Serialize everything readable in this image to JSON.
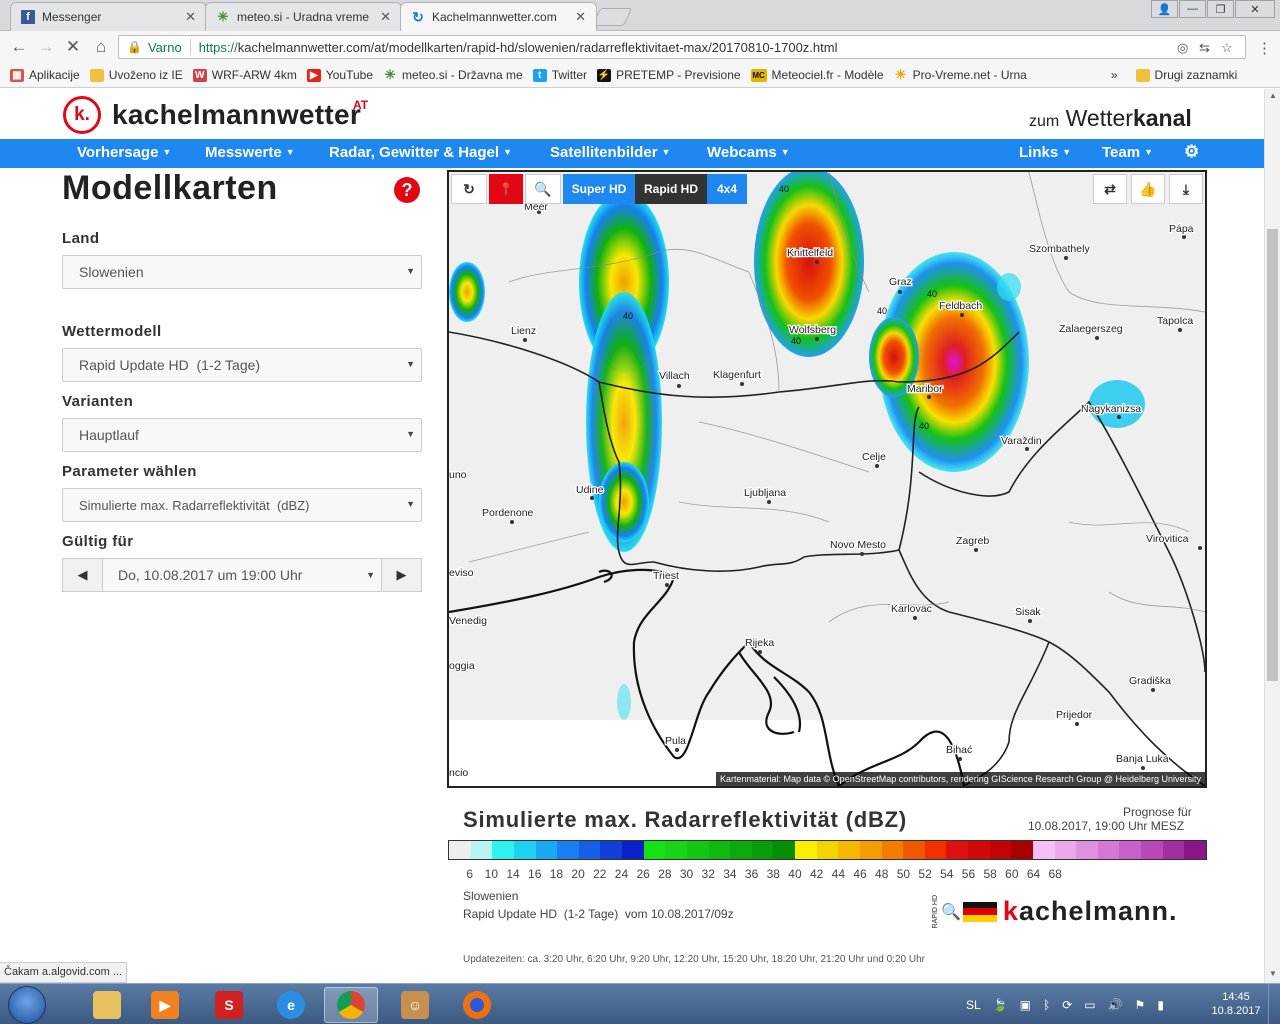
{
  "browser": {
    "tabs": [
      {
        "title": "Messenger",
        "color": "#3b5998",
        "glyph": "f"
      },
      {
        "title": "meteo.si - Uradna vreme",
        "color": "#4a8b3a",
        "glyph": "✳"
      },
      {
        "title": "Kachelmannwetter.com",
        "color": "#1a73e8",
        "glyph": "C"
      }
    ],
    "address": {
      "secure_label": "Varno",
      "url_scheme": "https://",
      "url_host": "kachelmannwetter.com",
      "url_path": "/at/modellkarten/rapid-hd/slowenien/radarreflektivitaet-max/20170810-1700z.html"
    },
    "bookmarks": [
      {
        "label": "Aplikacije",
        "color": "#d9534f",
        "glyph": "▦"
      },
      {
        "label": "Uvoženo iz IE",
        "color": "#f0c040",
        "glyph": ""
      },
      {
        "label": "WRF-ARW 4km",
        "color": "#c44",
        "glyph": "W"
      },
      {
        "label": "YouTube",
        "color": "#e62117",
        "glyph": "▶"
      },
      {
        "label": "meteo.si - Državna me",
        "color": "#4a8b3a",
        "glyph": "✳"
      },
      {
        "label": "Twitter",
        "color": "#1da1f2",
        "glyph": "t"
      },
      {
        "label": "PRETEMP - Previsione",
        "color": "#111",
        "glyph": "⚡"
      },
      {
        "label": "Meteociel.fr - Modèle",
        "color": "#e8b300",
        "glyph": "MC"
      },
      {
        "label": "Pro-Vreme.net - Urna",
        "color": "#f5a300",
        "glyph": "☀"
      }
    ],
    "bookmarks_more": "»",
    "bookmarks_other": "Drugi zaznamki",
    "status": "Čakam a.algovid.com ..."
  },
  "site": {
    "logo_letter": "k.",
    "logo_name": "kachelmannwetter",
    "logo_suffix": "AT",
    "wetterkanal_zum": "zum",
    "wetterkanal_wetter": "Wetter",
    "wetterkanal_kanal": "kanal",
    "nav": [
      {
        "label": "Vorhersage"
      },
      {
        "label": "Messwerte"
      },
      {
        "label": "Radar, Gewitter & Hagel"
      },
      {
        "label": "Satellitenbilder"
      },
      {
        "label": "Webcams"
      }
    ],
    "nav_right": [
      {
        "label": "Links"
      },
      {
        "label": "Team"
      }
    ]
  },
  "panel": {
    "title": "Modellkarten",
    "land_label": "Land",
    "land_value": "Slowenien",
    "model_label": "Wettermodell",
    "model_value": "Rapid Update HD  (1-2 Tage)",
    "variant_label": "Varianten",
    "variant_value": "Hauptlauf",
    "param_label": "Parameter wählen",
    "param_value": "Simulierte max. Radarreflektivität  (dBZ)",
    "valid_label": "Gültig für",
    "valid_value": "Do, 10.08.2017 um 19:00 Uhr"
  },
  "map": {
    "buttons": {
      "superhd": "Super HD",
      "rapidhd": "Rapid HD",
      "grid": "4x4"
    },
    "attribution": "Kartenmaterial: Map data © OpenStreetMap contributors, rendering GIScience Research Group @ Heidelberg University",
    "cities": [
      {
        "name": "Meer"
      },
      {
        "name": "Knittelfeld"
      },
      {
        "name": "Szombathely"
      },
      {
        "name": "Pápa"
      },
      {
        "name": "Graz"
      },
      {
        "name": "Feldbach"
      },
      {
        "name": "Lienz"
      },
      {
        "name": "Wolfsberg"
      },
      {
        "name": "Zalaegerszeg"
      },
      {
        "name": "Tapolca"
      },
      {
        "name": "Villach"
      },
      {
        "name": "Klagenfurt"
      },
      {
        "name": "Maribor"
      },
      {
        "name": "Nagykanizsa"
      },
      {
        "name": "Varaždin"
      },
      {
        "name": "Celje"
      },
      {
        "name": "Udine"
      },
      {
        "name": "Ljubljana"
      },
      {
        "name": "Pordenone"
      },
      {
        "name": "Novo Mesto"
      },
      {
        "name": "Zagreb"
      },
      {
        "name": "Virovitica"
      },
      {
        "name": "Triest"
      },
      {
        "name": "Karlovac"
      },
      {
        "name": "Sisak"
      },
      {
        "name": "Rijeka"
      },
      {
        "name": "Gradiška"
      },
      {
        "name": "Prijedor"
      },
      {
        "name": "Pula"
      },
      {
        "name": "Bihać"
      },
      {
        "name": "Banja Luka"
      },
      {
        "name": "Venedig"
      },
      {
        "name": "eviso"
      },
      {
        "name": "oggia"
      },
      {
        "name": "ncio"
      },
      {
        "name": "uno"
      }
    ],
    "contour_labels": [
      "40",
      "40",
      "40",
      "40",
      "40",
      "40"
    ]
  },
  "legend": {
    "title": "Simulierte max. Radarreflektivität (dBZ)",
    "prognose_label": "Prognose für",
    "prognose_value": "10.08.2017, 19:00 Uhr MESZ",
    "ticks": [
      "6",
      "10",
      "14",
      "16",
      "18",
      "20",
      "22",
      "24",
      "26",
      "28",
      "30",
      "32",
      "34",
      "36",
      "38",
      "40",
      "42",
      "44",
      "46",
      "48",
      "50",
      "52",
      "54",
      "56",
      "58",
      "60",
      "64",
      "68"
    ],
    "colors": [
      "#eeeeee",
      "#b8f4f4",
      "#2ef1f1",
      "#20d0f0",
      "#1aa8f0",
      "#1880f0",
      "#1560e8",
      "#1040d8",
      "#0a20c8",
      "#16e016",
      "#18d418",
      "#14c614",
      "#10b810",
      "#0daa0d",
      "#099c09",
      "#068e06",
      "#f8f000",
      "#f4d400",
      "#f4b800",
      "#f49c00",
      "#f47c00",
      "#f05800",
      "#f03000",
      "#e01010",
      "#d00808",
      "#c00404",
      "#a80000",
      "#f4c0f4",
      "#eca8ec",
      "#e090e0",
      "#d478d4",
      "#c860c8",
      "#b848b8",
      "#a030a0",
      "#881888"
    ],
    "country": "Slowenien",
    "model_run": "Rapid Update HD  (1-2 Tage)  vom 10.08.2017/09z",
    "updates": "Updatezeiten: ca. 3:20 Uhr, 6:20 Uhr, 9:20 Uhr, 12:20 Uhr, 15:20 Uhr, 18:20 Uhr, 21:20 Uhr und 0:20 Uhr",
    "brand_rapid": "RAPID HD",
    "brand_k": "k",
    "brand_rest": "achelmann."
  },
  "taskbar": {
    "lang": "SL",
    "time": "14:45",
    "date": "10.8.2017"
  }
}
